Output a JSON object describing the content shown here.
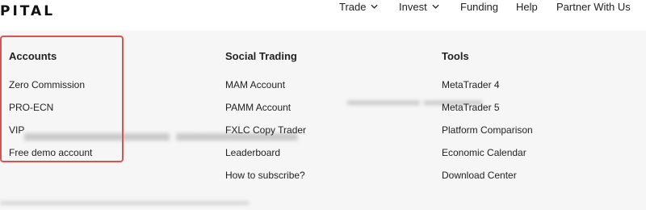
{
  "brand": {
    "logo_text": "PITAL"
  },
  "nav": {
    "items": [
      {
        "label": "Trade",
        "has_dropdown": true
      },
      {
        "label": "Invest",
        "has_dropdown": true
      },
      {
        "label": "Funding",
        "has_dropdown": false
      },
      {
        "label": "Help",
        "has_dropdown": false
      },
      {
        "label": "Partner With Us",
        "has_dropdown": false
      }
    ]
  },
  "menu": {
    "columns": [
      {
        "title": "Accounts",
        "links": [
          "Zero Commission",
          "PRO-ECN",
          "VIP",
          "Free demo account"
        ]
      },
      {
        "title": "Social Trading",
        "links": [
          "MAM Account",
          "PAMM Account",
          "FXLC Copy Trader",
          "Leaderboard",
          "How to subscribe?"
        ]
      },
      {
        "title": "Tools",
        "links": [
          "MetaTrader 4",
          "MetaTrader 5",
          "Platform Comparison",
          "Economic Calendar",
          "Download Center"
        ]
      }
    ]
  },
  "colors": {
    "highlight_border": "#d9534f",
    "panel_bg": "#f6f6f6"
  }
}
